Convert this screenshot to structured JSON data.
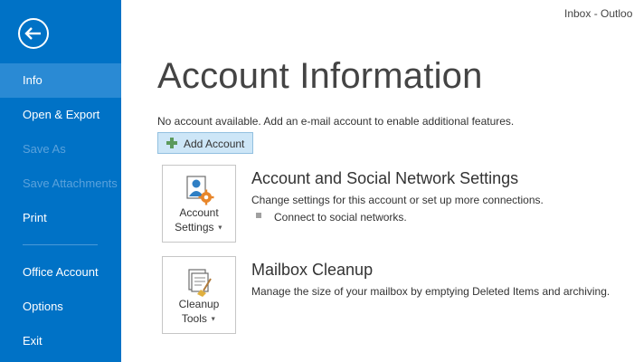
{
  "window": {
    "title": "Inbox - Outloo"
  },
  "sidebar": {
    "items": [
      {
        "label": "Info"
      },
      {
        "label": "Open & Export"
      },
      {
        "label": "Save As"
      },
      {
        "label": "Save Attachments"
      },
      {
        "label": "Print"
      },
      {
        "label": "Office Account"
      },
      {
        "label": "Options"
      },
      {
        "label": "Exit"
      }
    ],
    "accent": "#0072c6"
  },
  "main": {
    "title": "Account Information",
    "info_text": "No account available. Add an e-mail account to enable additional features.",
    "add_account_label": "Add Account",
    "account_settings": {
      "button_line1": "Account",
      "button_line2": "Settings",
      "title": "Account and Social Network Settings",
      "description": "Change settings for this account or set up more connections.",
      "bullet": "Connect to social networks."
    },
    "mailbox_cleanup": {
      "button_line1": "Cleanup",
      "button_line2": "Tools",
      "title": "Mailbox Cleanup",
      "description": "Manage the size of your mailbox by emptying Deleted Items and archiving."
    }
  }
}
